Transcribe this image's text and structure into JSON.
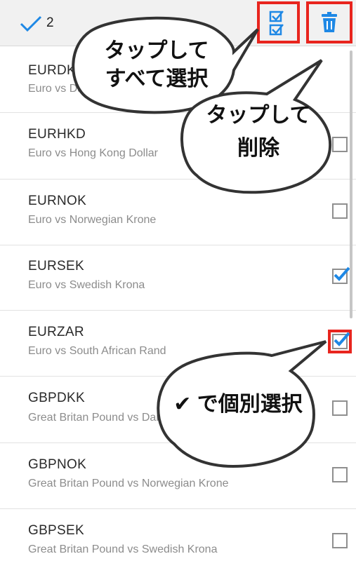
{
  "toolbar": {
    "selected_count": "2",
    "select_all_icon": "select-all-checklist-icon",
    "delete_icon": "trash-icon"
  },
  "colors": {
    "accent": "#1e88e5",
    "highlight": "#e8251e"
  },
  "rows": [
    {
      "symbol": "EURDKK",
      "description": "Euro vs Danish Krone",
      "checked": false
    },
    {
      "symbol": "EURHKD",
      "description": "Euro vs Hong Kong Dollar",
      "checked": false
    },
    {
      "symbol": "EURNOK",
      "description": "Euro vs Norwegian Krone",
      "checked": false
    },
    {
      "symbol": "EURSEK",
      "description": "Euro vs Swedish Krona",
      "checked": true
    },
    {
      "symbol": "EURZAR",
      "description": "Euro vs South African Rand",
      "checked": true
    },
    {
      "symbol": "GBPDKK",
      "description": "Great Britan Pound vs Danish Krone",
      "checked": false
    },
    {
      "symbol": "GBPNOK",
      "description": "Great Britan Pound vs Norwegian Krone",
      "checked": false
    },
    {
      "symbol": "GBPSEK",
      "description": "Great Britan Pound vs Swedish Krona",
      "checked": false
    }
  ],
  "callouts": {
    "select_all": {
      "line1": "タップして",
      "line2": "すべて選択"
    },
    "delete": {
      "line1": "タップして",
      "line2": "削除"
    },
    "individual": {
      "text": "✔ で個別選択"
    }
  }
}
